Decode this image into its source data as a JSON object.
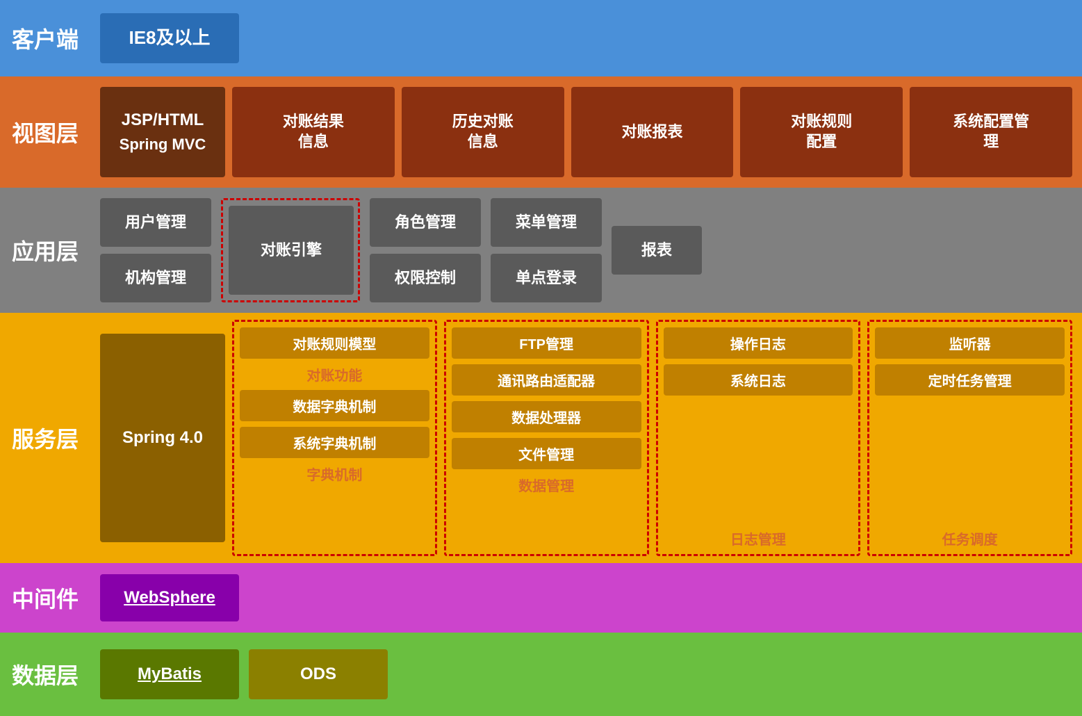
{
  "rows": {
    "client": {
      "label": "客户端",
      "ie_label": "IE8及以上"
    },
    "view": {
      "label": "视图层",
      "tech_line1": "JSP/HTML",
      "tech_line2": "Spring MVC",
      "modules": [
        "对账结果\n信息",
        "历史对账\n信息",
        "对账报表",
        "对账规则\n配置",
        "系统配置管\n理"
      ]
    },
    "app": {
      "label": "应用层",
      "col1": [
        "用户管理",
        "机构管理"
      ],
      "dashed_center": "对账引擎",
      "col3": [
        "角色管理",
        "权限控制"
      ],
      "col4": [
        "菜单管理",
        "单点登录"
      ],
      "col5": [
        "报表"
      ]
    },
    "service": {
      "label": "服务层",
      "spring_label": "Spring 4.0",
      "group1": {
        "label": "对账功能",
        "items": [
          "对账规则模型",
          "数据字典机制",
          "系统字典机制"
        ],
        "sub_label": "字典机制"
      },
      "group2": {
        "label": "数据管理",
        "items": [
          "FTP管理",
          "通讯路由适配器",
          "数据处理器",
          "文件管理"
        ]
      },
      "group3": {
        "label": "日志管理",
        "items": [
          "操作日志",
          "系统日志"
        ]
      },
      "group4": {
        "label": "任务调度",
        "items": [
          "监听器",
          "定时任务管理"
        ]
      }
    },
    "middleware": {
      "label": "中间件",
      "websphere_label": "WebSphere"
    },
    "data": {
      "label": "数据层",
      "mybatis_label": "MyBatis",
      "ods_label": "ODS"
    }
  }
}
